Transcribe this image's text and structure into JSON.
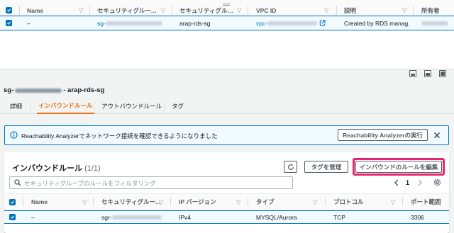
{
  "top_table": {
    "headers": [
      "Name",
      "セキュリティグループ...",
      "セキュリティグルー...",
      "VPC ID",
      "説明",
      "所有者"
    ],
    "row": {
      "name": "–",
      "sg_id_prefix": "sg-",
      "sg_name": "arap-rds-sg",
      "vpc_prefix": "vpc-",
      "description": "Created by RDS manag..."
    }
  },
  "detail": {
    "title_prefix": "sg-",
    "title_suffix": "- arap-rds-sg",
    "tabs": [
      "詳細",
      "インバウンドルール",
      "アウトバウンドルール",
      "タグ"
    ],
    "active_tab": 1
  },
  "banner": {
    "text": "Reachability Analyzerでネットワーク接続を確認できるようになりました",
    "button": "Reachability Analyzerの実行"
  },
  "rules_panel": {
    "title": "インバウンドルール",
    "count": "(1/1)",
    "manage_tags_button": "タグを管理",
    "edit_rules_button": "インバウンドのルールを編集",
    "search_placeholder": "セキュリティグループのルールをフィルタリング",
    "page": "1",
    "headers": [
      "Name",
      "セキュリティグルー...",
      "IP バージョン",
      "タイプ",
      "プロトコル",
      "ポート範囲"
    ],
    "row": {
      "name": "–",
      "rule_prefix": "sgr-",
      "ip_version": "IPv4",
      "type": "MYSQL/Aurora",
      "protocol": "TCP",
      "port_range": "3306"
    }
  },
  "colors": {
    "accent": "#0073bb",
    "active_tab": "#ec7211",
    "highlight": "#e8266f"
  }
}
